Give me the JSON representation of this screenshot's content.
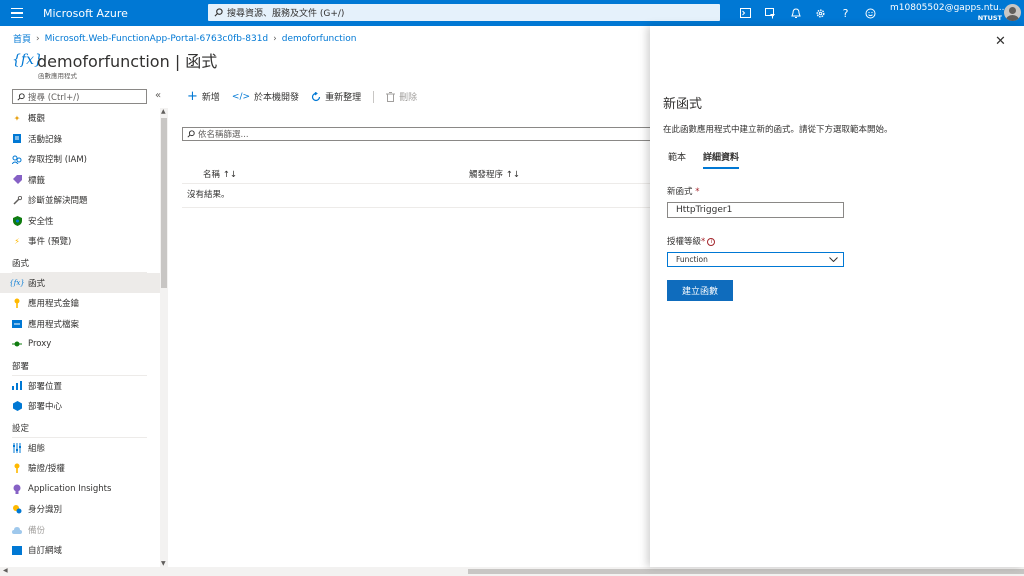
{
  "topbar": {
    "brand": "Microsoft Azure",
    "search_placeholder": "搜尋資源、服務及文件 (G+/)",
    "account_email": "m10805502@gapps.ntu...",
    "account_org": "NTUST"
  },
  "breadcrumb": [
    "首頁",
    "Microsoft.Web-FunctionApp-Portal-6763c0fb-831d",
    "demoforfunction"
  ],
  "header": {
    "title": "demoforfunction | 函式",
    "subtitle": "函數應用程式"
  },
  "sidebar": {
    "search_placeholder": "搜尋 (Ctrl+/)",
    "items_top": [
      {
        "label": "概觀",
        "icon": "overview-icon"
      },
      {
        "label": "活動記錄",
        "icon": "activity-log-icon"
      },
      {
        "label": "存取控制 (IAM)",
        "icon": "iam-icon"
      },
      {
        "label": "標籤",
        "icon": "tag-icon"
      },
      {
        "label": "診斷並解決問題",
        "icon": "wrench-icon"
      },
      {
        "label": "安全性",
        "icon": "shield-icon"
      },
      {
        "label": "事件 (預覽)",
        "icon": "lightning-icon"
      }
    ],
    "section_functions": "函式",
    "items_functions": [
      {
        "label": "函式",
        "icon": "function-icon"
      },
      {
        "label": "應用程式金鑰",
        "icon": "key-icon"
      },
      {
        "label": "應用程式檔案",
        "icon": "app-files-icon"
      },
      {
        "label": "Proxy",
        "icon": "proxy-icon"
      }
    ],
    "section_deploy": "部署",
    "items_deploy": [
      {
        "label": "部署位置",
        "icon": "deployment-slots-icon"
      },
      {
        "label": "部署中心",
        "icon": "deployment-center-icon"
      }
    ],
    "section_settings": "設定",
    "items_settings": [
      {
        "label": "組態",
        "icon": "configuration-icon"
      },
      {
        "label": "驗證/授權",
        "icon": "auth-key-icon"
      },
      {
        "label": "Application Insights",
        "icon": "app-insights-icon"
      },
      {
        "label": "身分識別",
        "icon": "identity-icon"
      },
      {
        "label": "備份",
        "icon": "backup-icon"
      },
      {
        "label": "自訂網域",
        "icon": "custom-domain-icon"
      }
    ]
  },
  "toolbar": {
    "add": "新增",
    "develop_local": "於本機開發",
    "refresh": "重新整理",
    "delete": "刪除"
  },
  "filter_placeholder": "依名稱篩選...",
  "table": {
    "col_name": "名稱 ↑↓",
    "col_trigger": "觸發程序 ↑↓",
    "empty": "沒有結果。"
  },
  "panel": {
    "title": "新函式",
    "description": "在此函數應用程式中建立新的函式。請從下方選取範本開始。",
    "tab_template": "範本",
    "tab_details": "詳細資料",
    "new_function_label": "新函式",
    "new_function_value": "HttpTrigger1",
    "auth_level_label": "授權等級",
    "auth_level_value": "Function",
    "create_button": "建立函數"
  }
}
